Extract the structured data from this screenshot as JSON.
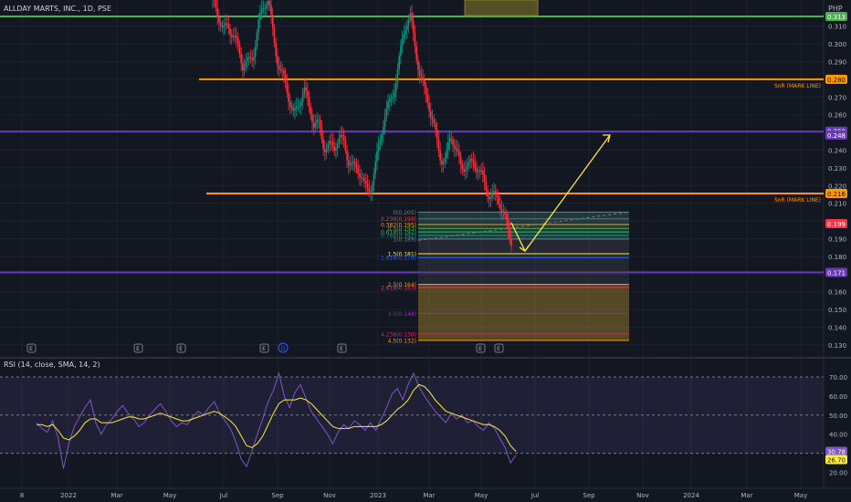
{
  "header": {
    "title": "ALLDAY MARTS, INC., 1D, PSE"
  },
  "price_axis": {
    "currency": "PHP",
    "ticks": [
      "0.310",
      "0.300",
      "0.290",
      "0.280",
      "0.270",
      "0.260",
      "0.250",
      "0.240",
      "0.230",
      "0.220",
      "0.210",
      "0.200",
      "0.190",
      "0.180",
      "0.170",
      "0.160",
      "0.150",
      "0.140",
      "0.130"
    ],
    "tick_values": [
      0.31,
      0.3,
      0.29,
      0.28,
      0.27,
      0.26,
      0.25,
      0.24,
      0.23,
      0.22,
      0.21,
      0.2,
      0.19,
      0.18,
      0.17,
      0.16,
      0.15,
      0.14,
      0.13
    ],
    "labels": [
      {
        "text": "0.313",
        "value": 0.3155,
        "bg": "#4caf50",
        "fg": "#ffffff"
      },
      {
        "text": "0.280",
        "value": 0.28,
        "bg": "#ff9800",
        "fg": "#131722"
      },
      {
        "text": "0.250",
        "value": 0.2507,
        "bg": "#673ab7",
        "fg": "#ffffff"
      },
      {
        "text": "0.248",
        "value": 0.2485,
        "bg": "#673ab7",
        "fg": "#ffffff"
      },
      {
        "text": "0.216",
        "value": 0.2155,
        "bg": "#ff9800",
        "fg": "#131722"
      },
      {
        "text": "0.199",
        "value": 0.1985,
        "bg": "#f23645",
        "fg": "#ffffff"
      },
      {
        "text": "0.171",
        "value": 0.171,
        "bg": "#673ab7",
        "fg": "#ffffff"
      }
    ]
  },
  "levels": [
    {
      "id": "green-line",
      "value": 0.3155,
      "color": "#4caf50",
      "x1": 0,
      "label": ""
    },
    {
      "id": "snr-280",
      "value": 0.28,
      "color": "#ff9800",
      "x1": 218,
      "label": "SnR (MARK LINE)"
    },
    {
      "id": "purple-250",
      "value": 0.2505,
      "color": "#673ab7",
      "x1": 0,
      "label": ""
    },
    {
      "id": "snr-216",
      "value": 0.2155,
      "color": "#ff9800",
      "x1": 226,
      "label": "SnR (MARK LINE)"
    },
    {
      "id": "purple-171",
      "value": 0.171,
      "color": "#673ab7",
      "x1": 0,
      "label": ""
    }
  ],
  "fib": {
    "labels": [
      {
        "text": "0(0.205)",
        "value": 0.205,
        "color": "#787b86"
      },
      {
        "text": "0.236(0.199)",
        "value": 0.2012,
        "color": "#f23645"
      },
      {
        "text": "0.382(0.195)",
        "value": 0.198,
        "color": "#ff9800"
      },
      {
        "text": "0.5(0.193)",
        "value": 0.1958,
        "color": "#4caf50"
      },
      {
        "text": "0.618(0.192)",
        "value": 0.1938,
        "color": "#4caf50"
      },
      {
        "text": "0.786(0.192)",
        "value": 0.1918,
        "color": "#089981"
      },
      {
        "text": "1(0.189)",
        "value": 0.1898,
        "color": "#787b86"
      },
      {
        "text": "1.5(0.181)",
        "value": 0.1815,
        "color": "#ffeb3b"
      },
      {
        "text": "1.618(0.179)",
        "value": 0.1793,
        "color": "#2962ff"
      },
      {
        "text": "2.5(0.164)",
        "value": 0.1642,
        "color": "#ff9800"
      },
      {
        "text": "2.618(0.163)",
        "value": 0.1625,
        "color": "#f23645"
      },
      {
        "text": "3.5(0.148)",
        "value": 0.1478,
        "color": "#9c27b0"
      },
      {
        "text": "4.236(0.136)",
        "value": 0.1362,
        "color": "#e91e63"
      },
      {
        "text": "4.5(0.132)",
        "value": 0.1325,
        "color": "#ff9800"
      }
    ]
  },
  "events": [
    "E",
    "E",
    "E",
    "E",
    "D",
    "E",
    "E",
    "E"
  ],
  "time_axis": [
    "8",
    "2022",
    "Mar",
    "May",
    "Jul",
    "Sep",
    "Nov",
    "2023",
    "Mar",
    "May",
    "Jul",
    "Sep",
    "Nov",
    "2024",
    "Mar",
    "May"
  ],
  "rsi": {
    "label": "RSI (14, close, SMA, 14, 2)",
    "ticks": [
      "70.00",
      "60.00",
      "50.00",
      "40.00",
      "20.00"
    ],
    "tick_values": [
      70,
      60,
      50,
      40,
      20
    ],
    "rsi_value": "30.78",
    "ma_value": "26.70",
    "rsi_values": [
      46,
      43,
      41,
      47,
      38,
      22,
      35,
      44,
      49,
      54,
      58,
      46,
      40,
      45,
      48,
      52,
      55,
      51,
      48,
      44,
      46,
      50,
      53,
      56,
      52,
      47,
      44,
      46,
      45,
      49,
      52,
      50,
      54,
      57,
      51,
      47,
      43,
      36,
      27,
      23,
      31,
      40,
      48,
      57,
      63,
      72,
      60,
      54,
      62,
      66,
      59,
      52,
      48,
      44,
      40,
      35,
      41,
      45,
      43,
      47,
      45,
      42,
      46,
      42,
      48,
      54,
      61,
      64,
      58,
      66,
      72,
      65,
      60,
      56,
      52,
      49,
      46,
      51,
      48,
      50,
      46,
      47,
      44,
      42,
      46,
      43,
      38,
      33,
      25,
      29
    ],
    "ma_values": [
      45,
      45,
      44,
      45,
      42,
      38,
      37,
      39,
      42,
      46,
      48,
      48,
      46,
      46,
      46,
      47,
      48,
      49,
      49,
      48,
      48,
      49,
      50,
      51,
      50,
      49,
      48,
      47,
      47,
      48,
      49,
      50,
      51,
      52,
      51,
      49,
      47,
      44,
      39,
      34,
      33,
      35,
      39,
      45,
      51,
      56,
      58,
      58,
      58,
      59,
      58,
      56,
      53,
      50,
      47,
      44,
      43,
      43,
      43,
      44,
      44,
      44,
      44,
      44,
      45,
      47,
      50,
      53,
      55,
      58,
      63,
      66,
      65,
      62,
      58,
      55,
      52,
      51,
      50,
      49,
      48,
      47,
      46,
      45,
      45,
      44,
      42,
      39,
      34,
      31
    ]
  },
  "chart_data": {
    "type": "candlestick",
    "title": "ALLDAY MARTS, INC., 1D, PSE",
    "ylim": [
      0.128,
      0.322
    ],
    "x_labels": [
      "8",
      "2022",
      "Mar",
      "May",
      "Jul",
      "Sep",
      "Nov",
      "2023",
      "Mar",
      "May",
      "Jul",
      "Sep",
      "Nov",
      "2024",
      "Mar",
      "May"
    ],
    "close_path": [
      0.325,
      0.313,
      0.305,
      0.315,
      0.308,
      0.296,
      0.283,
      0.29,
      0.298,
      0.312,
      0.318,
      0.322,
      0.306,
      0.292,
      0.28,
      0.266,
      0.258,
      0.27,
      0.278,
      0.262,
      0.251,
      0.255,
      0.246,
      0.243,
      0.238,
      0.244,
      0.247,
      0.236,
      0.229,
      0.224,
      0.219,
      0.221,
      0.231,
      0.242,
      0.256,
      0.268,
      0.281,
      0.294,
      0.306,
      0.314,
      0.301,
      0.286,
      0.27,
      0.258,
      0.249,
      0.24,
      0.236,
      0.245,
      0.238,
      0.232,
      0.236,
      0.232,
      0.227,
      0.225,
      0.222,
      0.217,
      0.212,
      0.204,
      0.199,
      0.193
    ],
    "close_start_x": 233,
    "close_end_x": 560,
    "projection": [
      {
        "x": 560,
        "y": 0.199
      },
      {
        "x": 575,
        "y": 0.183
      },
      {
        "x": 668,
        "y": 0.2485
      }
    ]
  }
}
